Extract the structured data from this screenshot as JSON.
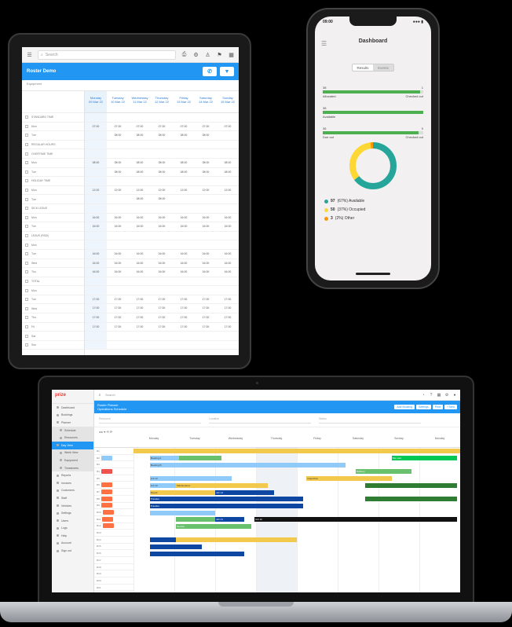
{
  "tablet": {
    "search_placeholder": "Search",
    "page_title": "Roster Demo",
    "filter_label": "Equipment",
    "filter_value": "Equipment",
    "columns": [
      "Monday\n09 Mar 22",
      "Tuesday\n10 Mar 22",
      "Wednesday\n11 Mar 22",
      "Thursday\n12 Mar 22",
      "Friday\n13 Mar 22",
      "Saturday\n14 Mar 22",
      "Sunday\n15 Mar 22"
    ],
    "side_rows": [
      "STANDARD TIME",
      "Mon",
      "Tue",
      "REGULAR HOURS",
      "OVERTIME TIME",
      "Mon",
      "Tue",
      "HOLIDAY TIME",
      "Mon",
      "Tue",
      "SICK LEAVE",
      "Mon",
      "Tue",
      "LEAVE (PAID)",
      "Mon",
      "Tue",
      "Wed",
      "Thu",
      "TOTAL",
      "Mon",
      "Tue",
      "Wed",
      "Thu",
      "Fri",
      "Sat",
      "Sun",
      "Total"
    ],
    "cell_rows": [
      [
        "",
        "",
        "",
        "",
        "",
        "",
        ""
      ],
      [
        "07:00",
        "07:00",
        "07:00",
        "07:00",
        "07:00",
        "07:00",
        "07:00"
      ],
      [
        "",
        "08:00",
        "08:00",
        "08:00",
        "08:00",
        "08:00",
        ""
      ],
      [
        "",
        "",
        "",
        "",
        "",
        "",
        ""
      ],
      [
        "",
        "",
        "",
        "",
        "",
        "",
        ""
      ],
      [
        "08:00",
        "08:00",
        "08:00",
        "08:00",
        "08:00",
        "08:00",
        "08:00"
      ],
      [
        "",
        "08:00",
        "08:00",
        "08:00",
        "08:00",
        "08:00",
        "08:00"
      ],
      [
        "",
        "",
        "",
        "",
        "",
        "",
        ""
      ],
      [
        "12:00",
        "12:00",
        "12:00",
        "12:00",
        "12:00",
        "12:00",
        "12:00"
      ],
      [
        "",
        "",
        "08:00",
        "08:00",
        "",
        "",
        ""
      ],
      [
        "",
        "",
        "",
        "",
        "",
        "",
        ""
      ],
      [
        "16:00",
        "16:00",
        "16:00",
        "16:00",
        "16:00",
        "16:00",
        "16:00"
      ],
      [
        "16:00",
        "16:00",
        "16:00",
        "16:00",
        "16:00",
        "16:00",
        "16:00"
      ],
      [
        "",
        "",
        "",
        "",
        "",
        "",
        ""
      ],
      [
        "",
        "",
        "",
        "",
        "",
        "",
        ""
      ],
      [
        "16:00",
        "16:00",
        "16:00",
        "16:00",
        "16:00",
        "16:00",
        "16:00"
      ],
      [
        "16:00",
        "16:00",
        "16:00",
        "16:00",
        "16:00",
        "16:00",
        "16:00"
      ],
      [
        "16:00",
        "16:00",
        "16:00",
        "16:00",
        "16:00",
        "16:00",
        "16:00"
      ],
      [
        "",
        "",
        "",
        "",
        "",
        "",
        ""
      ],
      [
        "",
        "",
        "",
        "",
        "",
        "",
        ""
      ],
      [
        "17:00",
        "17:00",
        "17:00",
        "17:00",
        "17:00",
        "17:00",
        "17:00"
      ],
      [
        "17:00",
        "17:00",
        "17:00",
        "17:00",
        "17:00",
        "17:00",
        "17:00"
      ],
      [
        "17:00",
        "17:00",
        "17:00",
        "17:00",
        "17:00",
        "17:00",
        "17:00"
      ],
      [
        "17:00",
        "17:00",
        "17:00",
        "17:00",
        "17:00",
        "17:00",
        "17:00"
      ],
      [
        "",
        "",
        "",
        "",
        "",
        "",
        ""
      ],
      [
        "",
        "",
        "",
        "",
        "",
        "",
        ""
      ]
    ]
  },
  "phone": {
    "time": "09:00",
    "status_right": "●●● ▮",
    "title": "Dashboard",
    "segments": [
      "Results",
      "Events"
    ],
    "bars": [
      {
        "left_num": "38",
        "right_num": "1",
        "left_label": "Allocated",
        "right_label": "Checked out",
        "fill": 0.97
      },
      {
        "left_num": "38",
        "right_num": "",
        "left_label": "Available",
        "right_label": "",
        "fill": 1.0
      },
      {
        "left_num": "36",
        "right_num": "0",
        "left_label": "Due out",
        "right_label": "Checked out",
        "fill": 0.95
      }
    ],
    "donut": {
      "available": 97,
      "occupied": 50,
      "other": 3
    },
    "legend": [
      {
        "count": "97",
        "text": "(67%)  Available",
        "color": "#26a69a"
      },
      {
        "count": "50",
        "text": "(37%)  Occupied",
        "color": "#fdd835"
      },
      {
        "count": "3",
        "text": "(2%)  Other",
        "color": "#ff9800"
      }
    ]
  },
  "laptop": {
    "logo": "prize",
    "search_placeholder": "Search",
    "title_line1": "Roster Planner",
    "title_line2": "Operations Schedule",
    "title_buttons": [
      "Add Booking",
      "Settings",
      "Print",
      "+ New"
    ],
    "filter_labels": [
      "Resource",
      "Location",
      "Status"
    ],
    "tools": "◂ ▸  ▾  ⟲ ⟳",
    "nav": [
      {
        "label": "Dashboard",
        "state": ""
      },
      {
        "label": "Bookings",
        "state": ""
      },
      {
        "label": "Planner",
        "state": ""
      },
      {
        "label": "Schedule",
        "state": "sub"
      },
      {
        "label": "Resources",
        "state": "sub"
      },
      {
        "label": "Day View",
        "state": "active"
      },
      {
        "label": "Week View",
        "state": "sub"
      },
      {
        "label": "Equipment",
        "state": "sub"
      },
      {
        "label": "Timesheets",
        "state": "sub"
      },
      {
        "label": "Reports",
        "state": ""
      },
      {
        "label": "Invoices",
        "state": ""
      },
      {
        "label": "Customers",
        "state": ""
      },
      {
        "label": "Staff",
        "state": ""
      },
      {
        "label": "Vehicles",
        "state": ""
      },
      {
        "label": "Settings",
        "state": ""
      },
      {
        "label": "Users",
        "state": ""
      },
      {
        "label": "Logs",
        "state": ""
      },
      {
        "label": "Help",
        "state": ""
      },
      {
        "label": "Account",
        "state": ""
      },
      {
        "label": "Sign out",
        "state": ""
      }
    ],
    "days": [
      "Monday",
      "Tuesday",
      "Wednesday",
      "Thursday",
      "Friday",
      "Saturday",
      "Sunday",
      "Monday"
    ],
    "rows": [
      "R1",
      "R2",
      "R3",
      "R4",
      "R5",
      "R6",
      "R7",
      "R8",
      "R9",
      "R10",
      "R11",
      "R12",
      "R13",
      "R14",
      "R15",
      "R16",
      "R17",
      "R18",
      "R19",
      "R20",
      "R21"
    ],
    "bars": [
      {
        "label": "",
        "color": "#f2c94c",
        "row": 0,
        "start": 0.0,
        "end": 1.0
      },
      {
        "label": "Booking A",
        "color": "#90caf9",
        "row": 1,
        "start": 0.05,
        "end": 0.27
      },
      {
        "label": "",
        "color": "#69c16d",
        "row": 1,
        "start": 0.14,
        "end": 0.27
      },
      {
        "label": "Site visit",
        "color": "#00c853",
        "row": 1,
        "start": 0.79,
        "end": 0.99
      },
      {
        "label": "Booking B",
        "color": "#90caf9",
        "row": 2,
        "start": 0.05,
        "end": 0.65
      },
      {
        "label": "Delivery",
        "color": "#69c16d",
        "row": 3,
        "start": 0.68,
        "end": 0.85
      },
      {
        "label": "Job 12",
        "color": "#90caf9",
        "row": 4,
        "start": 0.05,
        "end": 0.3
      },
      {
        "label": "Inspection",
        "color": "#f2c94c",
        "row": 4,
        "start": 0.53,
        "end": 0.79
      },
      {
        "label": "Job 12",
        "color": "#90caf9",
        "row": 5,
        "start": 0.05,
        "end": 0.28
      },
      {
        "label": "Maintenance",
        "color": "#f2c94c",
        "row": 5,
        "start": 0.13,
        "end": 0.41
      },
      {
        "label": "",
        "color": "#2e7d32",
        "row": 5,
        "start": 0.71,
        "end": 0.99
      },
      {
        "label": "Repair",
        "color": "#f2c94c",
        "row": 6,
        "start": 0.05,
        "end": 0.41
      },
      {
        "label": "Job 14",
        "color": "#0d47a1",
        "row": 6,
        "start": 0.25,
        "end": 0.43
      },
      {
        "label": "Transfer",
        "color": "#0d47a1",
        "row": 7,
        "start": 0.05,
        "end": 0.52
      },
      {
        "label": "",
        "color": "#2e7d32",
        "row": 7,
        "start": 0.71,
        "end": 0.99
      },
      {
        "label": "Transfer",
        "color": "#0d47a1",
        "row": 8,
        "start": 0.05,
        "end": 0.52
      },
      {
        "label": "",
        "color": "#90caf9",
        "row": 9,
        "start": 0.05,
        "end": 0.25
      },
      {
        "label": "",
        "color": "#69c16d",
        "row": 10,
        "start": 0.13,
        "end": 0.27
      },
      {
        "label": "Job 21",
        "color": "#0d47a1",
        "row": 10,
        "start": 0.25,
        "end": 0.34
      },
      {
        "label": "Job 22",
        "color": "#111111",
        "row": 10,
        "start": 0.37,
        "end": 0.99
      },
      {
        "label": "Service",
        "color": "#69c16d",
        "row": 11,
        "start": 0.13,
        "end": 0.36
      },
      {
        "label": "",
        "color": "#0d47a1",
        "row": 13,
        "start": 0.05,
        "end": 0.28
      },
      {
        "label": "",
        "color": "#f2c94c",
        "row": 13,
        "start": 0.13,
        "end": 0.5
      },
      {
        "label": "",
        "color": "#0d47a1",
        "row": 14,
        "start": 0.05,
        "end": 0.21
      },
      {
        "label": "",
        "color": "#0d47a1",
        "row": 15,
        "start": 0.05,
        "end": 0.34
      }
    ],
    "row_chips": [
      "",
      "#90caf9",
      "",
      "#ef5350",
      "",
      "#ff7043",
      "#ff7043",
      "#ff7043",
      "#ff7043",
      "#ff7043",
      "#ff7043",
      "#ff7043",
      "",
      "",
      "",
      "",
      "",
      "",
      "",
      "",
      ""
    ]
  }
}
